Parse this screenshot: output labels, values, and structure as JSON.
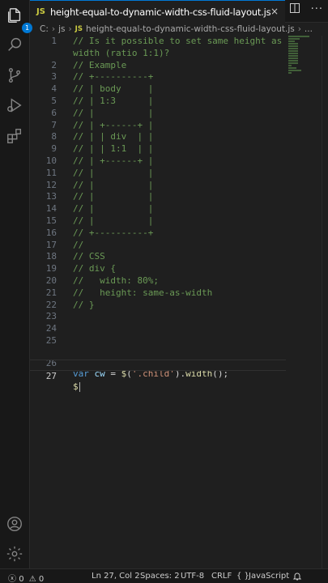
{
  "tab": {
    "lang_badge": "JS",
    "title": "height-equal-to-dynamic-width-css-fluid-layout.js",
    "close": "×"
  },
  "explorer_badge": "1",
  "breadcrumb": {
    "drive": "C:",
    "folder": "js",
    "lang_badge": "JS",
    "file": "height-equal-to-dynamic-width-css-fluid-layout.js",
    "more": "..."
  },
  "editor": {
    "lines": [
      {
        "n": "1",
        "t": "// Is it possible to set same height as"
      },
      {
        "n": "",
        "t": "width (ratio 1:1)?"
      },
      {
        "n": "2",
        "t": "// Example"
      },
      {
        "n": "3",
        "t": "// +----------+"
      },
      {
        "n": "4",
        "t": "// | body     |"
      },
      {
        "n": "5",
        "t": "// | 1:3      |"
      },
      {
        "n": "6",
        "t": "// |          |"
      },
      {
        "n": "7",
        "t": "// | +------+ |"
      },
      {
        "n": "8",
        "t": "// | | div  | |"
      },
      {
        "n": "9",
        "t": "// | | 1:1  | |"
      },
      {
        "n": "10",
        "t": "// | +------+ |"
      },
      {
        "n": "11",
        "t": "// |          |"
      },
      {
        "n": "12",
        "t": "// |          |"
      },
      {
        "n": "13",
        "t": "// |          |"
      },
      {
        "n": "14",
        "t": "// |          |"
      },
      {
        "n": "15",
        "t": "// |          |"
      },
      {
        "n": "16",
        "t": "// +----------+"
      },
      {
        "n": "17",
        "t": "//"
      },
      {
        "n": "18",
        "t": "// CSS"
      },
      {
        "n": "19",
        "t": "// div {"
      },
      {
        "n": "20",
        "t": "//   width: 80%;"
      },
      {
        "n": "21",
        "t": "//   height: same-as-width"
      },
      {
        "n": "22",
        "t": "// }"
      },
      {
        "n": "23",
        "t": ""
      },
      {
        "n": "24",
        "t": ""
      },
      {
        "n": "25",
        "t": ""
      }
    ],
    "line26": {
      "n": "26",
      "kw": "var",
      "var": "cw",
      "eq": " = ",
      "fn": "$",
      "p1": "(",
      "str": "'.child'",
      "p2": ").",
      "method": "width",
      "p3": "();"
    },
    "line27": {
      "n": "27",
      "fn": "$"
    }
  },
  "status": {
    "errors": "0",
    "warnings": "0",
    "position": "Ln 27, Col 2",
    "spaces": "Spaces: 2",
    "encoding": "UTF-8",
    "eol": "CRLF",
    "braces": "{ }",
    "language": "JavaScript"
  },
  "colors": {
    "accent": "#0078d4",
    "comment": "#6a9955",
    "keyword": "#569cd6",
    "string": "#ce9178",
    "function": "#dcdcaa",
    "variable": "#9cdcfe"
  }
}
